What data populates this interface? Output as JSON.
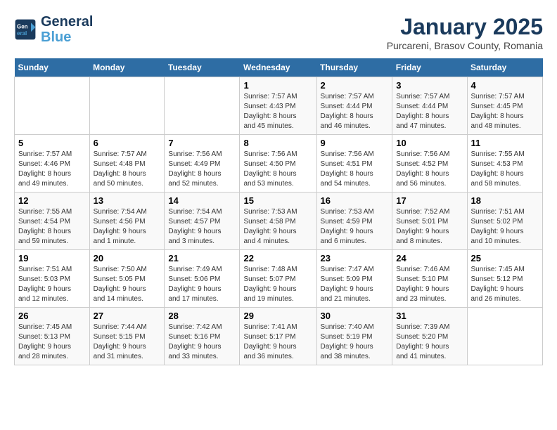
{
  "logo": {
    "line1": "General",
    "line2": "Blue"
  },
  "title": "January 2025",
  "subtitle": "Purcareni, Brasov County, Romania",
  "days_of_week": [
    "Sunday",
    "Monday",
    "Tuesday",
    "Wednesday",
    "Thursday",
    "Friday",
    "Saturday"
  ],
  "weeks": [
    [
      {
        "day": "",
        "info": ""
      },
      {
        "day": "",
        "info": ""
      },
      {
        "day": "",
        "info": ""
      },
      {
        "day": "1",
        "info": "Sunrise: 7:57 AM\nSunset: 4:43 PM\nDaylight: 8 hours\nand 45 minutes."
      },
      {
        "day": "2",
        "info": "Sunrise: 7:57 AM\nSunset: 4:44 PM\nDaylight: 8 hours\nand 46 minutes."
      },
      {
        "day": "3",
        "info": "Sunrise: 7:57 AM\nSunset: 4:44 PM\nDaylight: 8 hours\nand 47 minutes."
      },
      {
        "day": "4",
        "info": "Sunrise: 7:57 AM\nSunset: 4:45 PM\nDaylight: 8 hours\nand 48 minutes."
      }
    ],
    [
      {
        "day": "5",
        "info": "Sunrise: 7:57 AM\nSunset: 4:46 PM\nDaylight: 8 hours\nand 49 minutes."
      },
      {
        "day": "6",
        "info": "Sunrise: 7:57 AM\nSunset: 4:48 PM\nDaylight: 8 hours\nand 50 minutes."
      },
      {
        "day": "7",
        "info": "Sunrise: 7:56 AM\nSunset: 4:49 PM\nDaylight: 8 hours\nand 52 minutes."
      },
      {
        "day": "8",
        "info": "Sunrise: 7:56 AM\nSunset: 4:50 PM\nDaylight: 8 hours\nand 53 minutes."
      },
      {
        "day": "9",
        "info": "Sunrise: 7:56 AM\nSunset: 4:51 PM\nDaylight: 8 hours\nand 54 minutes."
      },
      {
        "day": "10",
        "info": "Sunrise: 7:56 AM\nSunset: 4:52 PM\nDaylight: 8 hours\nand 56 minutes."
      },
      {
        "day": "11",
        "info": "Sunrise: 7:55 AM\nSunset: 4:53 PM\nDaylight: 8 hours\nand 58 minutes."
      }
    ],
    [
      {
        "day": "12",
        "info": "Sunrise: 7:55 AM\nSunset: 4:54 PM\nDaylight: 8 hours\nand 59 minutes."
      },
      {
        "day": "13",
        "info": "Sunrise: 7:54 AM\nSunset: 4:56 PM\nDaylight: 9 hours\nand 1 minute."
      },
      {
        "day": "14",
        "info": "Sunrise: 7:54 AM\nSunset: 4:57 PM\nDaylight: 9 hours\nand 3 minutes."
      },
      {
        "day": "15",
        "info": "Sunrise: 7:53 AM\nSunset: 4:58 PM\nDaylight: 9 hours\nand 4 minutes."
      },
      {
        "day": "16",
        "info": "Sunrise: 7:53 AM\nSunset: 4:59 PM\nDaylight: 9 hours\nand 6 minutes."
      },
      {
        "day": "17",
        "info": "Sunrise: 7:52 AM\nSunset: 5:01 PM\nDaylight: 9 hours\nand 8 minutes."
      },
      {
        "day": "18",
        "info": "Sunrise: 7:51 AM\nSunset: 5:02 PM\nDaylight: 9 hours\nand 10 minutes."
      }
    ],
    [
      {
        "day": "19",
        "info": "Sunrise: 7:51 AM\nSunset: 5:03 PM\nDaylight: 9 hours\nand 12 minutes."
      },
      {
        "day": "20",
        "info": "Sunrise: 7:50 AM\nSunset: 5:05 PM\nDaylight: 9 hours\nand 14 minutes."
      },
      {
        "day": "21",
        "info": "Sunrise: 7:49 AM\nSunset: 5:06 PM\nDaylight: 9 hours\nand 17 minutes."
      },
      {
        "day": "22",
        "info": "Sunrise: 7:48 AM\nSunset: 5:07 PM\nDaylight: 9 hours\nand 19 minutes."
      },
      {
        "day": "23",
        "info": "Sunrise: 7:47 AM\nSunset: 5:09 PM\nDaylight: 9 hours\nand 21 minutes."
      },
      {
        "day": "24",
        "info": "Sunrise: 7:46 AM\nSunset: 5:10 PM\nDaylight: 9 hours\nand 23 minutes."
      },
      {
        "day": "25",
        "info": "Sunrise: 7:45 AM\nSunset: 5:12 PM\nDaylight: 9 hours\nand 26 minutes."
      }
    ],
    [
      {
        "day": "26",
        "info": "Sunrise: 7:45 AM\nSunset: 5:13 PM\nDaylight: 9 hours\nand 28 minutes."
      },
      {
        "day": "27",
        "info": "Sunrise: 7:44 AM\nSunset: 5:15 PM\nDaylight: 9 hours\nand 31 minutes."
      },
      {
        "day": "28",
        "info": "Sunrise: 7:42 AM\nSunset: 5:16 PM\nDaylight: 9 hours\nand 33 minutes."
      },
      {
        "day": "29",
        "info": "Sunrise: 7:41 AM\nSunset: 5:17 PM\nDaylight: 9 hours\nand 36 minutes."
      },
      {
        "day": "30",
        "info": "Sunrise: 7:40 AM\nSunset: 5:19 PM\nDaylight: 9 hours\nand 38 minutes."
      },
      {
        "day": "31",
        "info": "Sunrise: 7:39 AM\nSunset: 5:20 PM\nDaylight: 9 hours\nand 41 minutes."
      },
      {
        "day": "",
        "info": ""
      }
    ]
  ]
}
